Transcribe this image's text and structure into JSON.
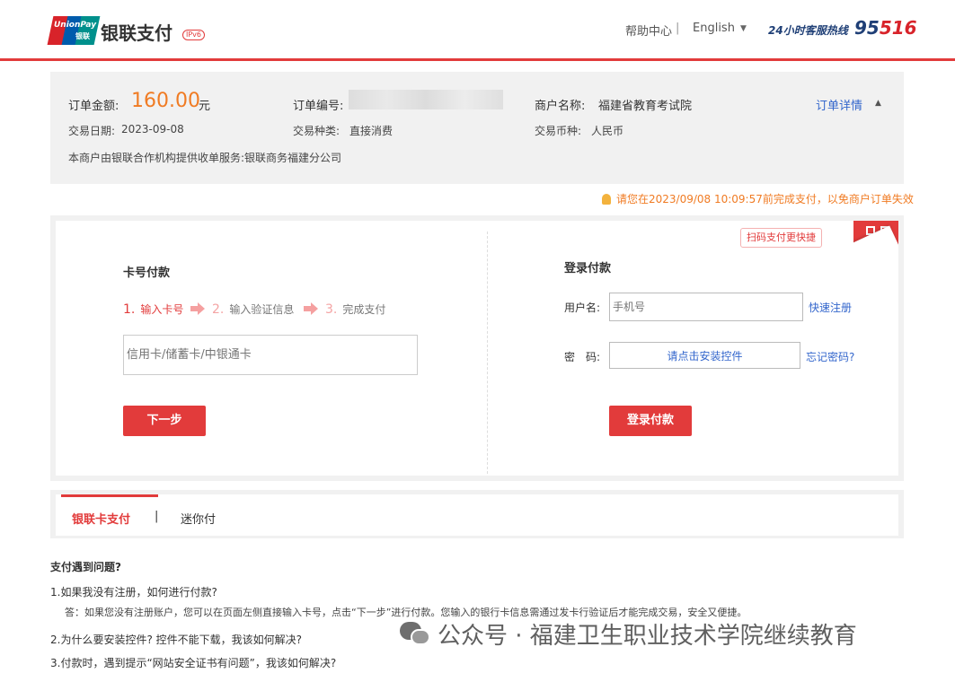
{
  "header": {
    "logo_text": "UnionPay",
    "logo_text_cn": "银联",
    "brand": "银联支付",
    "ipv6_badge": "IPv6",
    "help": "帮助中心",
    "separator": "|",
    "language": "English",
    "hotline_label": "24小时客服热线",
    "hotline_number_a": "95",
    "hotline_number_b": "516"
  },
  "order": {
    "amount_label": "订单金额:",
    "amount": "160.00",
    "amount_unit": "元",
    "order_no_label": "订单编号:",
    "merchant_label": "商户名称:",
    "merchant": "福建省教育考试院",
    "detail_link": "订单详情",
    "date_label": "交易日期:",
    "date": "2023-09-08",
    "type_label": "交易种类:",
    "type": "直接消费",
    "currency_label": "交易币种:",
    "currency": "人民币",
    "service_note": "本商户由银联合作机构提供收单服务:银联商务福建分公司"
  },
  "notice": "请您在2023/09/08 10:09:57前完成支付，以免商户订单失效",
  "card_pay": {
    "title": "卡号付款",
    "steps": [
      {
        "num": "1.",
        "label": "输入卡号"
      },
      {
        "num": "2.",
        "label": "输入验证信息"
      },
      {
        "num": "3.",
        "label": "完成支付"
      }
    ],
    "card_placeholder": "信用卡/储蓄卡/中银通卡",
    "next_button": "下一步"
  },
  "login_pay": {
    "title": "登录付款",
    "qr_tip": "扫码支付更快捷",
    "username_label": "用户名:",
    "username_placeholder": "手机号",
    "register_link": "快速注册",
    "password_label": "密　码:",
    "password_control": "请点击安装控件",
    "forgot_link": "忘记密码?",
    "login_button": "登录付款"
  },
  "tabs": {
    "active": "银联卡支付",
    "separator": "|",
    "other": "迷你付"
  },
  "faq": {
    "title": "支付遇到问题?",
    "q1": "1.如果我没有注册，如何进行付款?",
    "a1": "答：如果您没有注册账户，您可以在页面左侧直接输入卡号，点击“下一步”进行付款。您输入的银行卡信息需通过发卡行验证后才能完成交易，安全又便捷。",
    "q2": "2.为什么要安装控件? 控件不能下载，我该如何解决?",
    "q3": "3.付款时，遇到提示“网站安全证书有问题”，我该如何解决?"
  },
  "watermark": "公众号 · 福建卫生职业技术学院继续教育",
  "colors": {
    "accent_red": "#e23b3b",
    "amount_orange": "#f07b23",
    "link_blue": "#3366cc",
    "hotline_navy": "#1f3f76"
  }
}
